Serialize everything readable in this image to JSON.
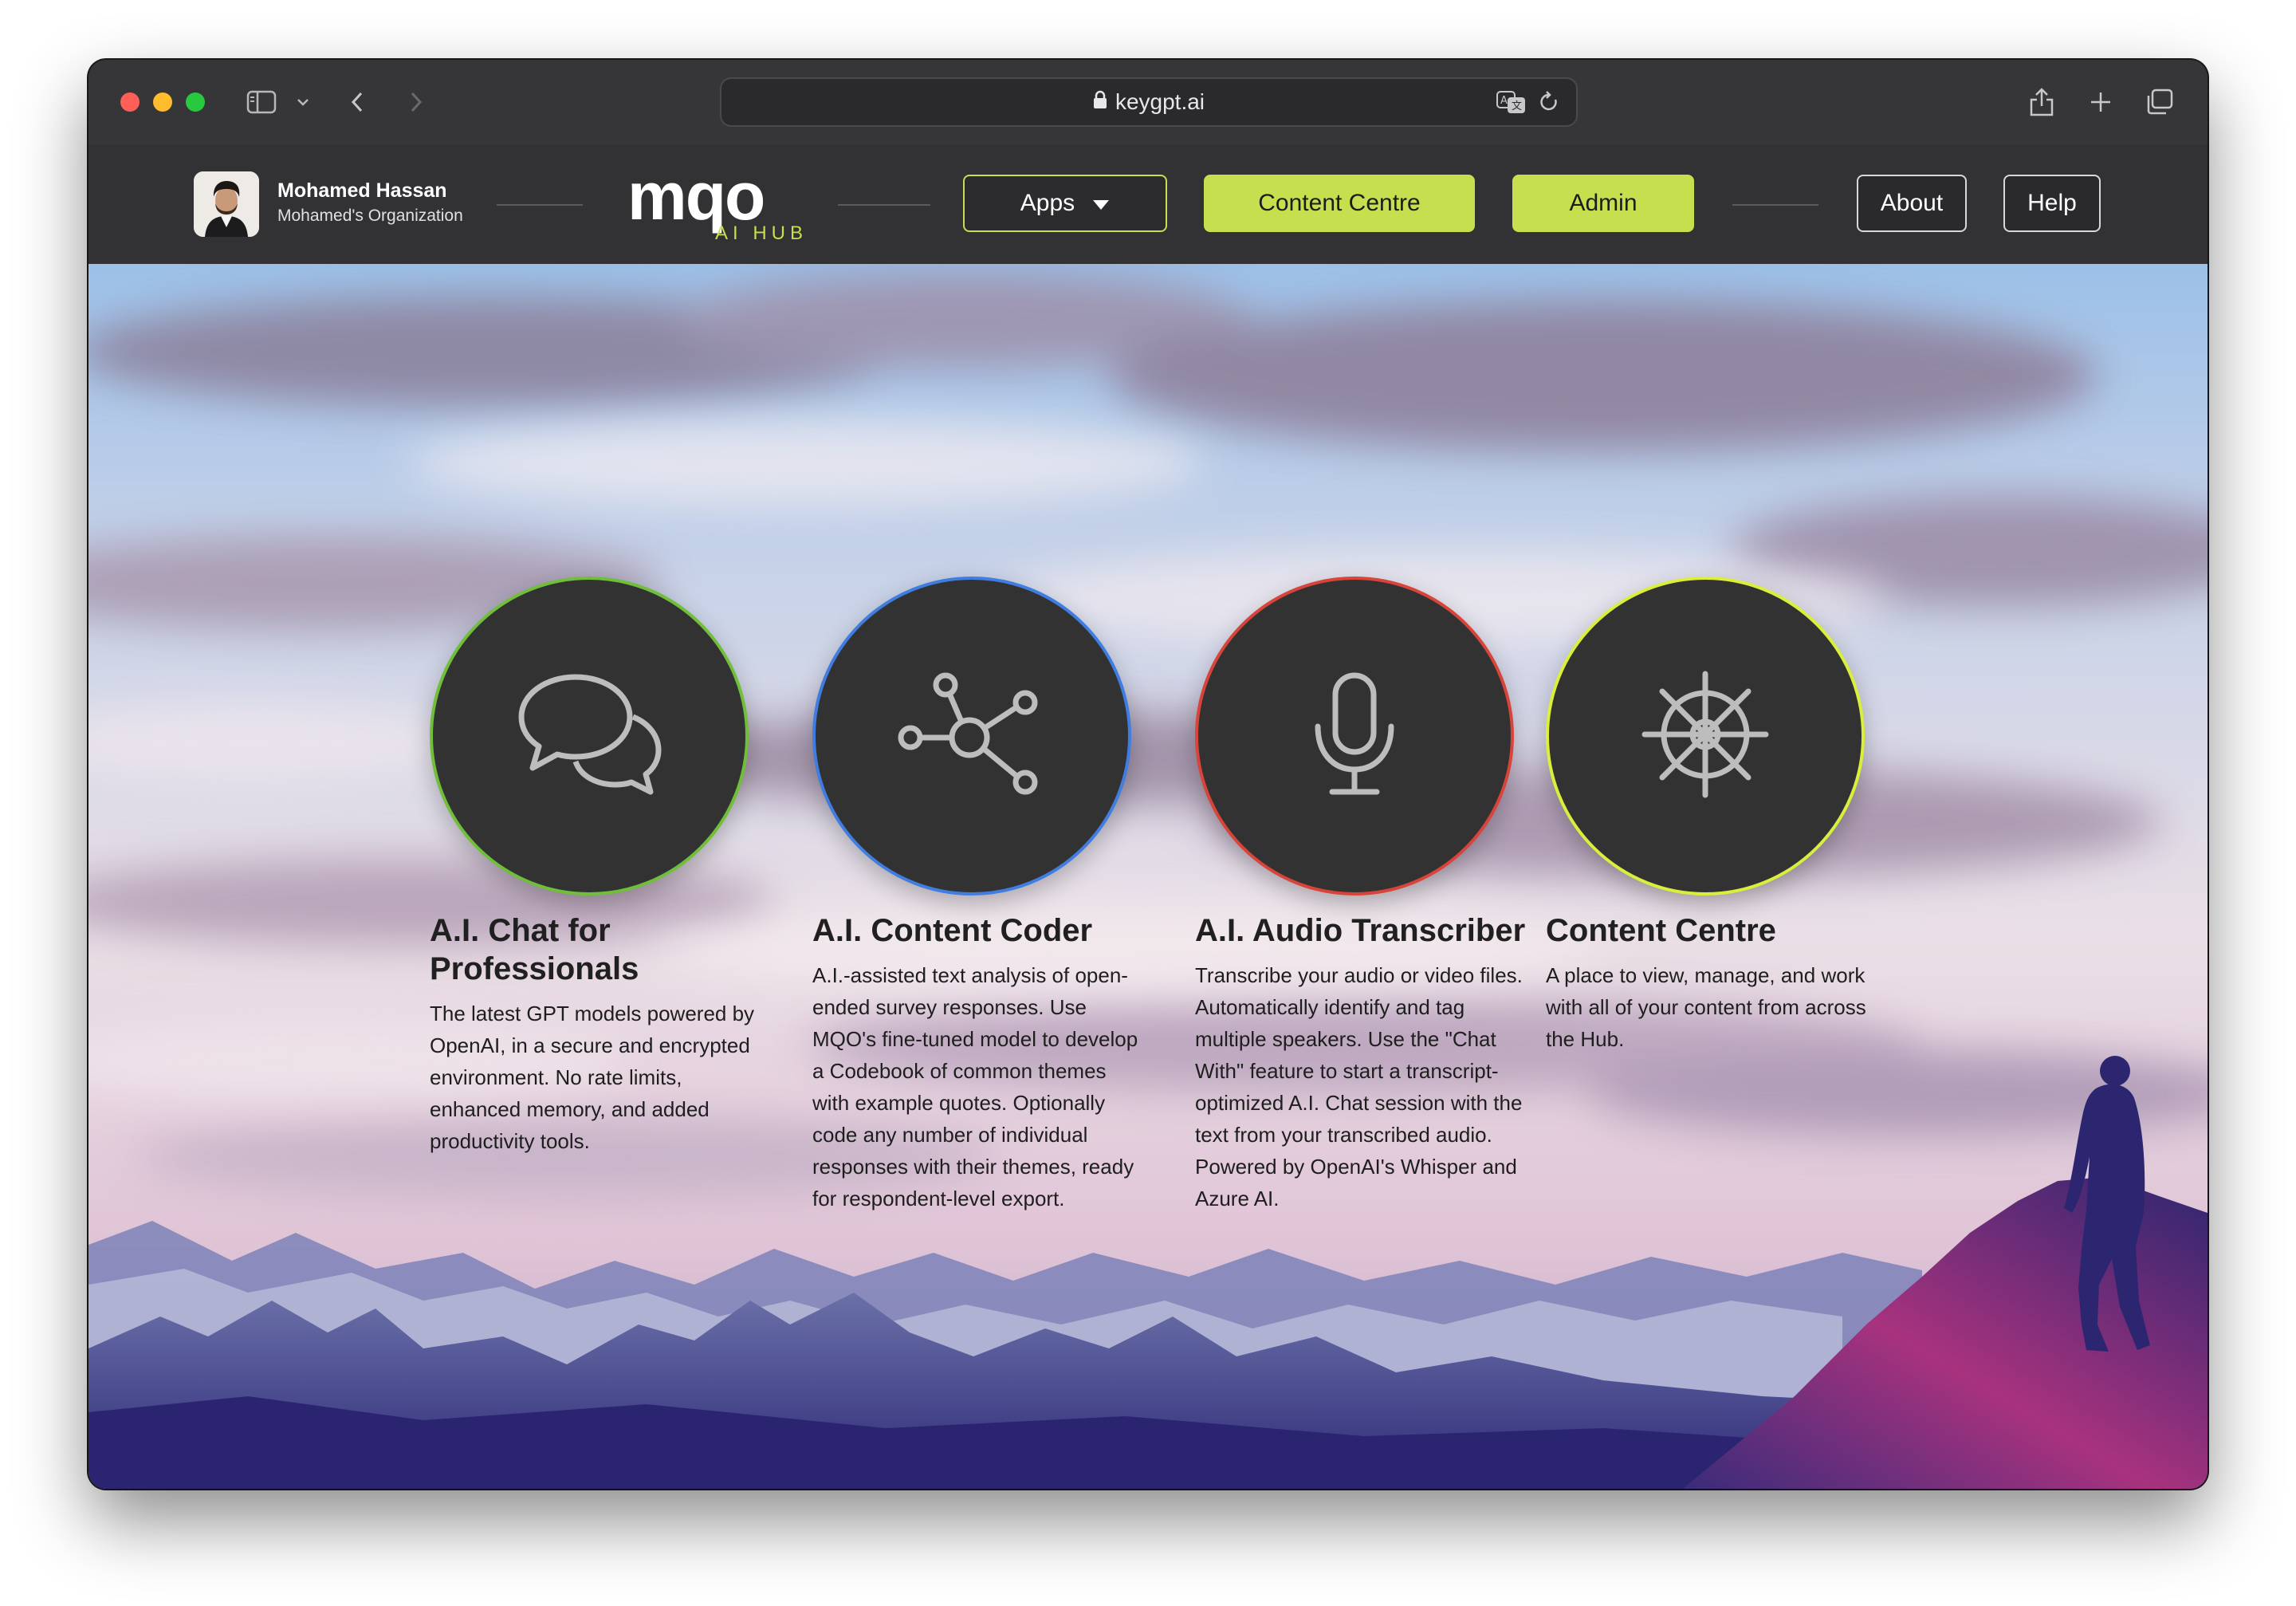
{
  "browser": {
    "url": "keygpt.ai"
  },
  "navbar": {
    "user_name": "Mohamed Hassan",
    "user_org": "Mohamed's Organization",
    "logo_text": "MQO",
    "logo_sub": "AI HUB",
    "apps_label": "Apps",
    "content_centre_label": "Content Centre",
    "admin_label": "Admin",
    "about_label": "About",
    "help_label": "Help"
  },
  "cards": [
    {
      "title": "A.I. Chat for Professionals",
      "description": "The latest GPT models powered by OpenAI, in a secure and encrypted environment. No rate limits, enhanced memory, and added productivity tools.",
      "icon": "chat-bubbles-icon",
      "ring_color": "#6fbf3a"
    },
    {
      "title": "A.I. Content Coder",
      "description": "A.I.-assisted text analysis of open-ended survey responses. Use MQO's fine-tuned model to develop a Codebook of common themes with example quotes. Optionally code any number of individual responses with their themes, ready for respondent-level export.",
      "icon": "network-nodes-icon",
      "ring_color": "#3f7de0"
    },
    {
      "title": "A.I. Audio Transcriber",
      "description": "Transcribe your audio or video files. Automatically identify and tag multiple speakers. Use the \"Chat With\" feature to start a transcript-optimized A.I. Chat session with the text from your transcribed audio. Powered by OpenAI's Whisper and Azure AI.",
      "icon": "microphone-icon",
      "ring_color": "#d8443a"
    },
    {
      "title": "Content Centre",
      "description": "A place to view, manage, and work with all of your content from across the Hub.",
      "icon": "ship-wheel-icon",
      "ring_color": "#d9ef3c"
    }
  ],
  "colors": {
    "accent_green": "#c5df4f",
    "navbar_bg": "#323234",
    "card_bg": "#323233"
  }
}
